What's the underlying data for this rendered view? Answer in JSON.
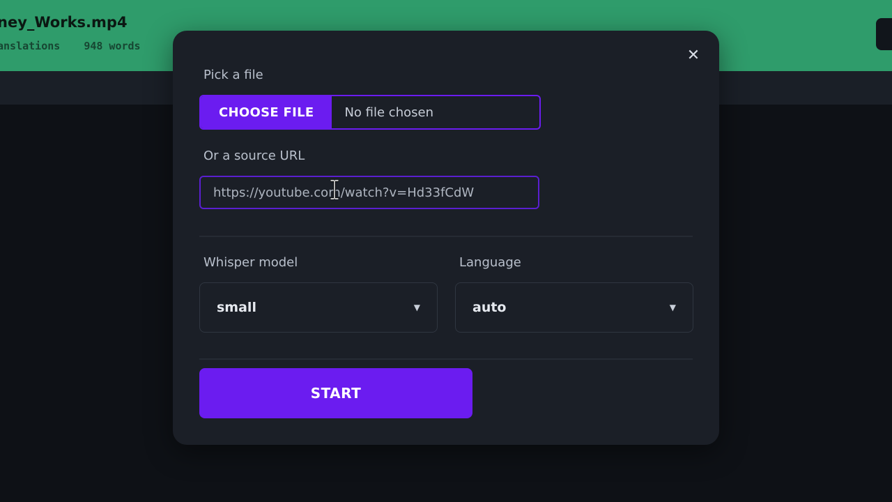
{
  "background": {
    "file_title": "ney_Works.mp4",
    "meta_left": "anslations",
    "meta_words": "948 words"
  },
  "modal": {
    "close_glyph": "✕",
    "pick_label": "Pick a file",
    "choose_button": "CHOOSE FILE",
    "file_status": "No file chosen",
    "url_label": "Or a source URL",
    "url_value": "https://youtube.com/watch?v=Hd33fCdW",
    "model_label": "Whisper model",
    "model_value": "small",
    "language_label": "Language",
    "language_value": "auto",
    "caret_glyph": "▼",
    "start_button": "START"
  },
  "colors": {
    "header_green": "#2f9c6b",
    "accent_purple": "#6b1cf0",
    "modal_bg": "#1b1f27"
  },
  "icons": {
    "close": "close-icon",
    "dropdown": "chevron-down-icon",
    "cursor": "text-cursor-icon"
  }
}
